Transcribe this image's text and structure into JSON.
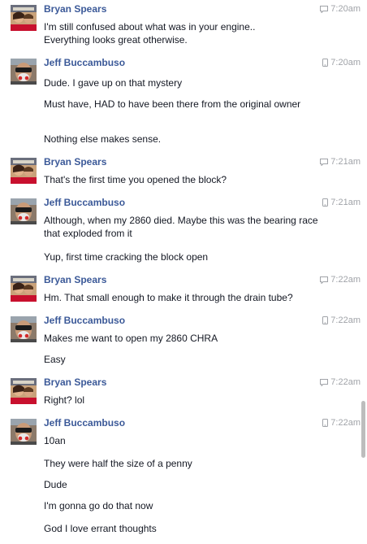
{
  "messages": [
    {
      "sender": "Bryan Spears",
      "time": "7:20am",
      "device_icon": "chat-icon",
      "avatar": "bryan-avatar",
      "lines": [
        "I'm still confused about what was in your engine..\nEverything looks great otherwise."
      ]
    },
    {
      "sender": "Jeff Buccambuso",
      "time": "7:20am",
      "device_icon": "mobile-icon",
      "avatar": "jeff-avatar",
      "lines": [
        "Dude. I gave up on that mystery",
        "Must have, HAD to have been there from the original owner",
        "Nothing else makes sense."
      ]
    },
    {
      "sender": "Bryan Spears",
      "time": "7:21am",
      "device_icon": "chat-icon",
      "avatar": "bryan-avatar",
      "lines": [
        "That's the first time you opened the block?"
      ]
    },
    {
      "sender": "Jeff Buccambuso",
      "time": "7:21am",
      "device_icon": "mobile-icon",
      "avatar": "jeff-avatar",
      "lines": [
        "Although, when my 2860 died. Maybe this was the bearing race that exploded from it",
        "Yup, first time cracking the block open"
      ]
    },
    {
      "sender": "Bryan Spears",
      "time": "7:22am",
      "device_icon": "chat-icon",
      "avatar": "bryan-avatar",
      "lines": [
        "Hm. That small enough to make it through the drain tube?"
      ]
    },
    {
      "sender": "Jeff Buccambuso",
      "time": "7:22am",
      "device_icon": "mobile-icon",
      "avatar": "jeff-avatar",
      "lines": [
        "Makes me want to open my 2860 CHRA",
        "Easy"
      ]
    },
    {
      "sender": "Bryan Spears",
      "time": "7:22am",
      "device_icon": "chat-icon",
      "avatar": "bryan-avatar",
      "lines": [
        "Right? lol"
      ]
    },
    {
      "sender": "Jeff Buccambuso",
      "time": "7:22am",
      "device_icon": "mobile-icon",
      "avatar": "jeff-avatar",
      "lines": [
        "10an",
        "They were half the size of a penny",
        "Dude",
        "I'm gonna go do that now",
        "God I love errant thoughts"
      ]
    }
  ],
  "colors": {
    "sender": "#3b5998",
    "text": "#141823",
    "timestamp": "#a0a3a8"
  }
}
